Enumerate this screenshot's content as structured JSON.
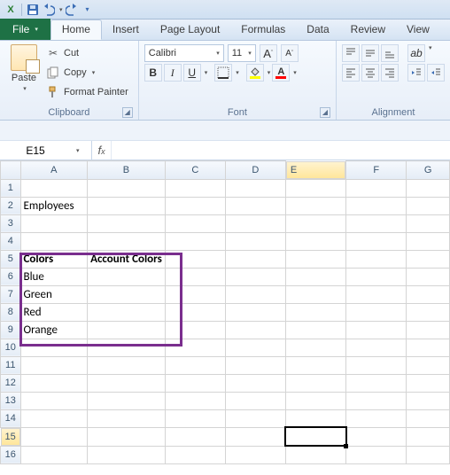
{
  "qat": {
    "save_title": "Save",
    "undo_title": "Undo",
    "redo_title": "Redo",
    "customize_title": "Customize Quick Access Toolbar"
  },
  "tabs": {
    "file": "File",
    "home": "Home",
    "insert": "Insert",
    "pagelayout": "Page Layout",
    "formulas": "Formulas",
    "data": "Data",
    "review": "Review",
    "view": "View"
  },
  "clipboard": {
    "paste": "Paste",
    "cut": "Cut",
    "copy": "Copy",
    "format": "Format Painter",
    "group": "Clipboard"
  },
  "font": {
    "name": "Calibri",
    "size": "11",
    "group": "Font",
    "bold": "B",
    "italic": "I",
    "underline": "U",
    "incfont": "A",
    "decfont": "A",
    "fontcolor": "A",
    "fillcolor_hex": "#ffff00",
    "fontcolor_hex": "#ff0000"
  },
  "align": {
    "group": "Alignment"
  },
  "namebox": "E15",
  "formula": "",
  "columns": [
    "A",
    "B",
    "C",
    "D",
    "E",
    "F",
    "G"
  ],
  "rows": [
    "1",
    "2",
    "3",
    "4",
    "5",
    "6",
    "7",
    "8",
    "9",
    "10",
    "11",
    "12",
    "13",
    "14",
    "15",
    "16"
  ],
  "cells": {
    "A2": "Employees",
    "A5": "Colors",
    "B5": "Account Colors",
    "A6": "Blue",
    "A7": "Green",
    "A8": "Red",
    "A9": "Orange"
  },
  "selected": "E15",
  "chart_data": {
    "type": "table",
    "title": "",
    "columns": [
      "Colors",
      "Account Colors"
    ],
    "rows": [
      [
        "Blue",
        ""
      ],
      [
        "Green",
        ""
      ],
      [
        "Red",
        ""
      ],
      [
        "Orange",
        ""
      ]
    ]
  }
}
